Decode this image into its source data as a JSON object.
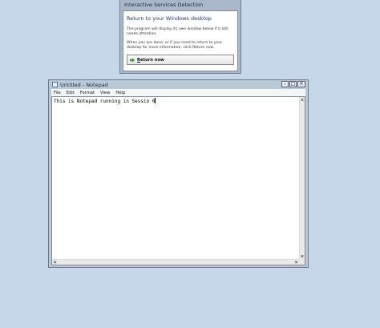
{
  "isd": {
    "title": "Interactive Services Detection",
    "heading": "Return to your Windows desktop",
    "text1": "The program will display its own window below if it still needs attention.",
    "text2": "When you are done, or if you need to return to your desktop for more information, click Return now.",
    "return_button": {
      "mnemonic": "R",
      "rest": "eturn now"
    },
    "arrow_icon": "green-arrow-icon"
  },
  "notepad": {
    "title": "Untitled - Notepad",
    "menus": [
      "File",
      "Edit",
      "Format",
      "View",
      "Help"
    ],
    "content": "This is Notepad running in Sessio 0",
    "controls": {
      "minimize": "–",
      "maximize": "□",
      "close": "✕"
    },
    "scroll": {
      "up": "▲",
      "down": "▼",
      "left": "◀",
      "right": "▶"
    }
  },
  "colors": {
    "desktop": "#c6d7ea",
    "accent_heading": "#1e3a66",
    "arrow": "#3aa63a"
  }
}
